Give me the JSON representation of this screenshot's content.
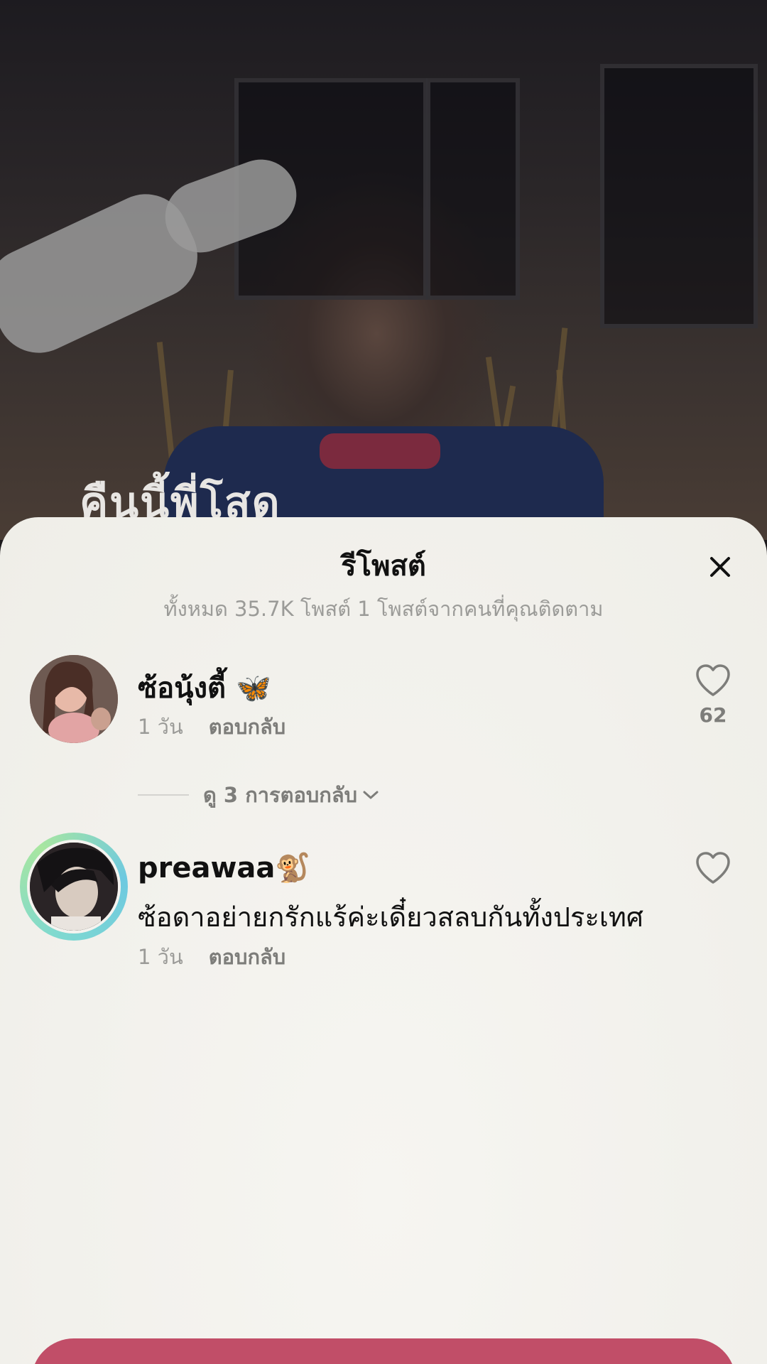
{
  "video": {
    "caption": "คืนนี้พี่โสด"
  },
  "sheet": {
    "title": "รีโพสต์",
    "subtitle": "ทั้งหมด 35.7K โพสต์ 1 โพสต์จากคนที่คุณติดตาม"
  },
  "comments": [
    {
      "username": "ซ้อนุ้งตี้ 🦋",
      "text": "",
      "time": "1 วัน",
      "reply_label": "ตอบกลับ",
      "likes": "62"
    },
    {
      "username": "preawaa🐒",
      "text": "ซ้อดาอย่ายกรักแร้ค่ะเดี๋ยวสลบกันทั้งประเทศ",
      "time": "1 วัน",
      "reply_label": "ตอบกลับ",
      "likes": ""
    }
  ],
  "view_replies": "ดู 3 การตอบกลับ",
  "icons": {
    "close": "close-icon",
    "like": "heart-outline-icon",
    "expand": "chevron-down-icon"
  },
  "colors": {
    "accent_button": "#c14e68",
    "sheet_background": "#f2f1ec",
    "muted_text": "#9b9b98"
  }
}
